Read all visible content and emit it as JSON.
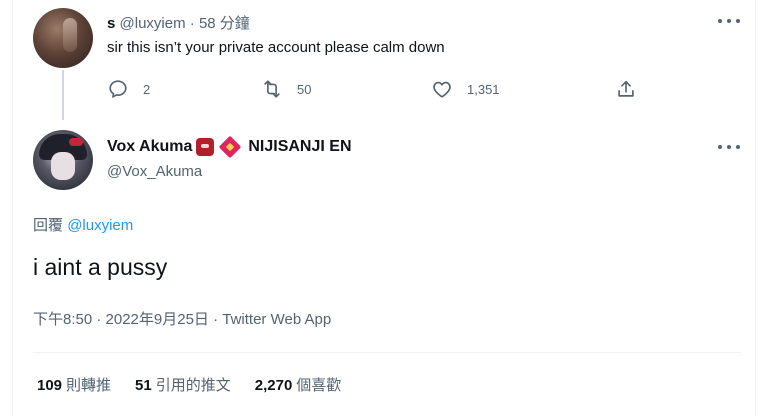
{
  "tweet1": {
    "display_name": "s",
    "handle": "@luxyiem",
    "separator": "·",
    "time": "58 分鐘",
    "text": "sir this isn’t your private account please calm down",
    "replies": "2",
    "retweets": "50",
    "likes": "1,351"
  },
  "tweet2": {
    "display_name": "Vox Akuma",
    "affiliation": "NIJISANJI EN",
    "handle": "@Vox_Akuma",
    "reply_prefix": "回覆",
    "reply_to": "@luxyiem",
    "text": "i aint a pussy",
    "meta": "下午8:50 · 2022年9月25日 · Twitter Web App",
    "retweet_count": "109",
    "retweet_label": "則轉推",
    "quote_count": "51",
    "quote_label": "引用的推文",
    "like_count": "2,270",
    "like_label": "個喜歡"
  },
  "icons": [
    "reply-icon",
    "retweet-icon",
    "like-icon",
    "share-icon",
    "more-icon",
    "demon-emoji-icon",
    "red-envelope-emoji-icon"
  ],
  "colors": {
    "link": "#1d9bf0",
    "muted": "#536471",
    "text": "#0f1419"
  }
}
